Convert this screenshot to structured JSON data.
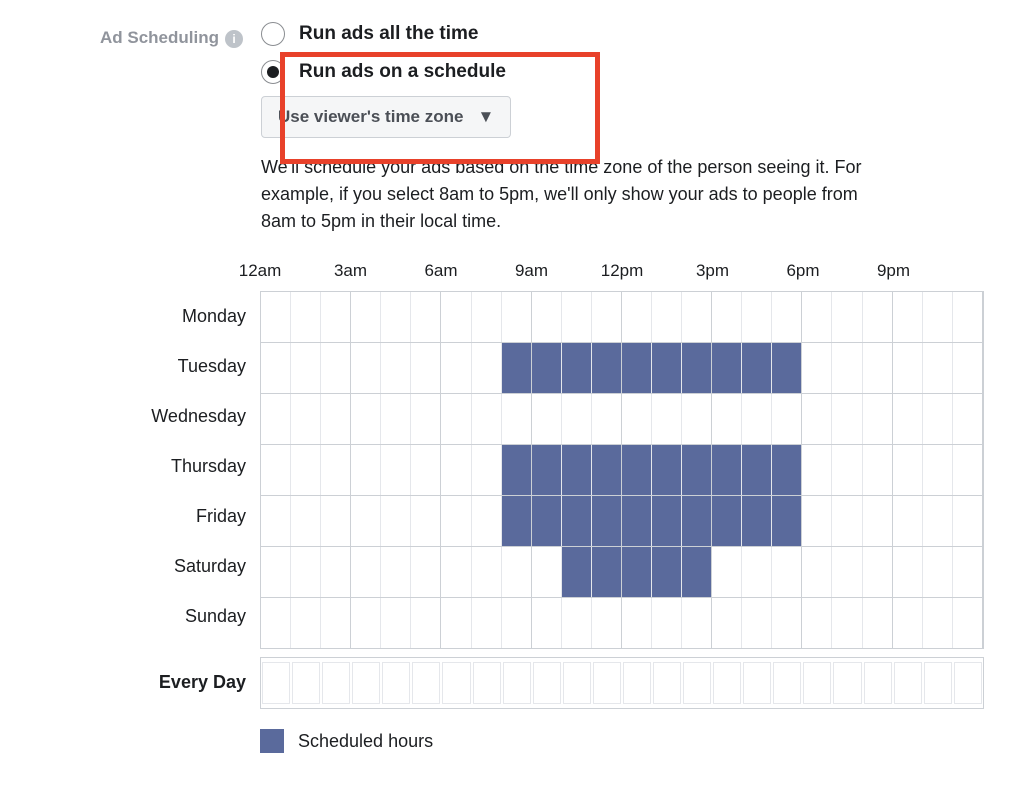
{
  "section_label": "Ad Scheduling",
  "options": {
    "all": "Run ads all the time",
    "schedule": "Run ads on a schedule",
    "selected": "schedule"
  },
  "timezone_dropdown": {
    "label": "Use viewer's time zone"
  },
  "description": "We'll schedule your ads based on the time zone of the person seeing it. For example, if you select 8am to 5pm, we'll only show your ads to people from 8am to 5pm in their local time.",
  "hour_labels": [
    "12am",
    "3am",
    "6am",
    "9am",
    "12pm",
    "3pm",
    "6pm",
    "9pm"
  ],
  "days": [
    "Monday",
    "Tuesday",
    "Wednesday",
    "Thursday",
    "Friday",
    "Saturday",
    "Sunday"
  ],
  "every_day_label": "Every Day",
  "legend": "Scheduled hours",
  "schedule": {
    "Monday": [],
    "Tuesday": [
      8,
      9,
      10,
      11,
      12,
      13,
      14,
      15,
      16,
      17
    ],
    "Wednesday": [],
    "Thursday": [
      8,
      9,
      10,
      11,
      12,
      13,
      14,
      15,
      16,
      17
    ],
    "Friday": [
      8,
      9,
      10,
      11,
      12,
      13,
      14,
      15,
      16,
      17
    ],
    "Saturday": [
      10,
      11,
      12,
      13,
      14
    ],
    "Sunday": []
  },
  "colors": {
    "selected": "#5a6a9c",
    "highlight": "#e8412a"
  }
}
